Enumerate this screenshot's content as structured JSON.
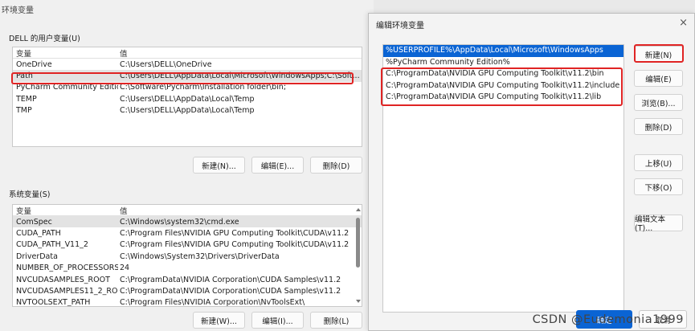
{
  "env_window": {
    "title": "环境变量",
    "user_group_label": "DELL 的用户变量(U)",
    "system_group_label": "系统变量(S)",
    "user_list": {
      "col_var": "变量",
      "col_val": "值",
      "rows": [
        {
          "name": "OneDrive",
          "value": "C:\\Users\\DELL\\OneDrive"
        },
        {
          "name": "Path",
          "value": "C:\\Users\\DELL\\AppData\\Local\\Microsoft\\WindowsApps;C:\\Soft..."
        },
        {
          "name": "PyCharm Community Edition",
          "value": "C:\\Software\\Pycharm\\Installation folder\\bin;"
        },
        {
          "name": "TEMP",
          "value": "C:\\Users\\DELL\\AppData\\Local\\Temp"
        },
        {
          "name": "TMP",
          "value": "C:\\Users\\DELL\\AppData\\Local\\Temp"
        }
      ]
    },
    "user_buttons": {
      "new": "新建(N)...",
      "edit": "编辑(E)...",
      "delete": "删除(D)"
    },
    "system_list": {
      "col_var": "变量",
      "col_val": "值",
      "rows": [
        {
          "name": "ComSpec",
          "value": "C:\\Windows\\system32\\cmd.exe"
        },
        {
          "name": "CUDA_PATH",
          "value": "C:\\Program Files\\NVIDIA GPU Computing Toolkit\\CUDA\\v11.2"
        },
        {
          "name": "CUDA_PATH_V11_2",
          "value": "C:\\Program Files\\NVIDIA GPU Computing Toolkit\\CUDA\\v11.2"
        },
        {
          "name": "DriverData",
          "value": "C:\\Windows\\System32\\Drivers\\DriverData"
        },
        {
          "name": "NUMBER_OF_PROCESSORS",
          "value": "24"
        },
        {
          "name": "NVCUDASAMPLES_ROOT",
          "value": "C:\\ProgramData\\NVIDIA Corporation\\CUDA Samples\\v11.2"
        },
        {
          "name": "NVCUDASAMPLES11_2_RO...",
          "value": "C:\\ProgramData\\NVIDIA Corporation\\CUDA Samples\\v11.2"
        },
        {
          "name": "NVTOOLSEXT_PATH",
          "value": "C:\\Program Files\\NVIDIA Corporation\\NvToolsExt\\"
        }
      ]
    },
    "system_buttons": {
      "new": "新建(W)...",
      "edit": "编辑(I)...",
      "delete": "删除(L)"
    }
  },
  "edit_dialog": {
    "title": "编辑环境变量",
    "close_glyph": "×",
    "entries": [
      "%USERPROFILE%\\AppData\\Local\\Microsoft\\WindowsApps",
      "%PyCharm Community Edition%",
      "C:\\ProgramData\\NVIDIA GPU Computing Toolkit\\v11.2\\bin",
      "C:\\ProgramData\\NVIDIA GPU Computing Toolkit\\v11.2\\include",
      "C:\\ProgramData\\NVIDIA GPU Computing Toolkit\\v11.2\\lib"
    ],
    "buttons": {
      "new": "新建(N)",
      "edit": "编辑(E)",
      "browse": "浏览(B)...",
      "delete": "删除(D)",
      "move_up": "上移(U)",
      "move_down": "下移(O)",
      "edit_text": "编辑文本(T)..."
    },
    "footer": {
      "ok": "确定",
      "cancel": "取消"
    }
  },
  "watermark": "CSDN @Eudemonia1999",
  "colors": {
    "highlight": "#e02424",
    "selection": "#0a64d4"
  }
}
